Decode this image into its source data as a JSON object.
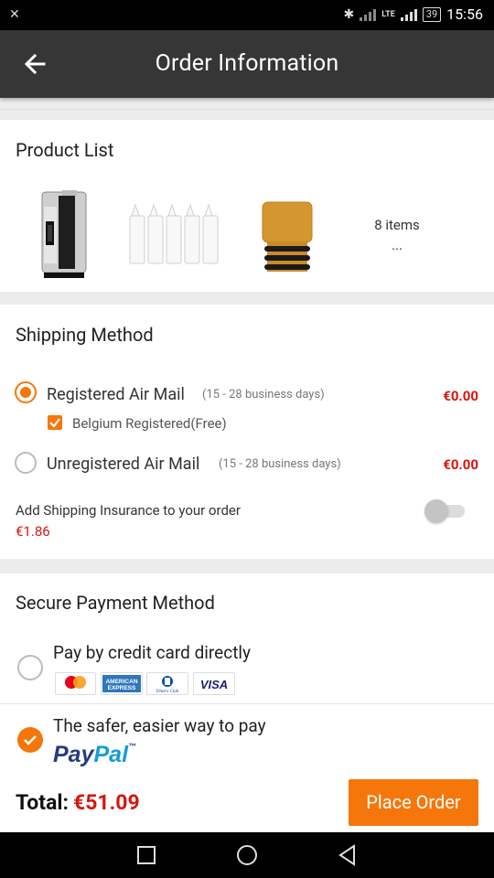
{
  "status_bar": {
    "time": "15:56",
    "battery": "39",
    "network": "LTE"
  },
  "app_bar": {
    "title": "Order Information",
    "back_icon": "arrow-left-icon"
  },
  "product_list": {
    "title": "Product List",
    "products": [
      {
        "icon": "box-mod-device-image"
      },
      {
        "icon": "dropper-bottles-image"
      },
      {
        "icon": "drip-tip-image"
      }
    ],
    "items_count": "8 items",
    "more": "..."
  },
  "shipping": {
    "title": "Shipping Method",
    "options": [
      {
        "name": "Registered Air Mail",
        "days": "(15 - 28 business days)",
        "price": "€0.00",
        "selected": true
      },
      {
        "name": "Unregistered Air Mail",
        "days": "(15 - 28 business days)",
        "price": "€0.00",
        "selected": false
      }
    ],
    "sub_option": {
      "label": "Belgium Registered(Free)",
      "checked": true
    },
    "insurance": {
      "label": "Add Shipping Insurance to your order",
      "price": "€1.86",
      "enabled": false
    }
  },
  "payment": {
    "title": "Secure Payment Method",
    "options": [
      {
        "label": "Pay by credit card directly",
        "selected": false
      },
      {
        "label": "The safer, easier way to pay",
        "selected": true
      }
    ],
    "cards": [
      {
        "name": "mastercard",
        "text": "mastercard"
      },
      {
        "name": "amex",
        "text": "AMERICAN EXPRESS"
      },
      {
        "name": "diners",
        "text": "Diners Club"
      },
      {
        "name": "visa",
        "text": "VISA"
      }
    ],
    "paypal": {
      "pay": "Pay",
      "pal": "Pal",
      "tm": "™"
    }
  },
  "footer": {
    "total_label": "Total:",
    "total_value": "€51.09",
    "place_order": "Place Order"
  },
  "colors": {
    "accent": "#f5760a",
    "price_red": "#d8140c",
    "appbar": "#363636",
    "paypal_dark": "#253b80",
    "paypal_light": "#179bd7"
  }
}
